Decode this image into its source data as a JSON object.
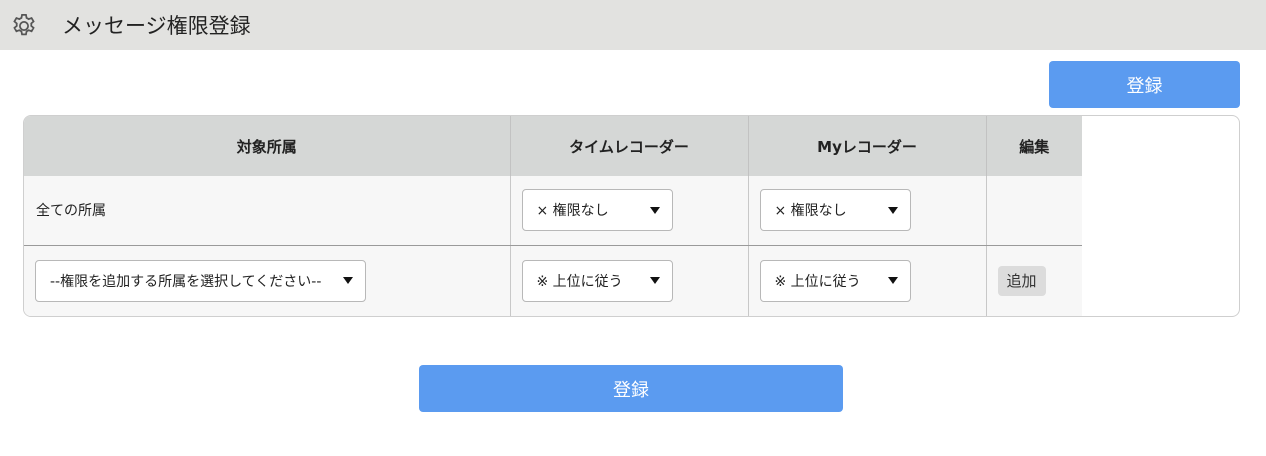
{
  "header": {
    "title": "メッセージ権限登録",
    "icon": "gear-icon"
  },
  "top_button": {
    "label": "登録"
  },
  "bottom_button": {
    "label": "登録"
  },
  "table": {
    "headers": [
      "対象所属",
      "タイムレコーダー",
      "Myレコーダー",
      "編集"
    ],
    "rows": [
      {
        "target": "全ての所属",
        "time": "× 権限なし",
        "my": "× 権限なし",
        "edit": ""
      },
      {
        "target_select": "--権限を追加する所属を選択してください--",
        "time": "※ 上位に従う",
        "my": "※ 上位に従う",
        "edit": "追加"
      }
    ]
  },
  "colors": {
    "accent": "#5b9bf0",
    "header_bg": "#e2e2e0",
    "table_header_bg": "#d5d7d6"
  }
}
